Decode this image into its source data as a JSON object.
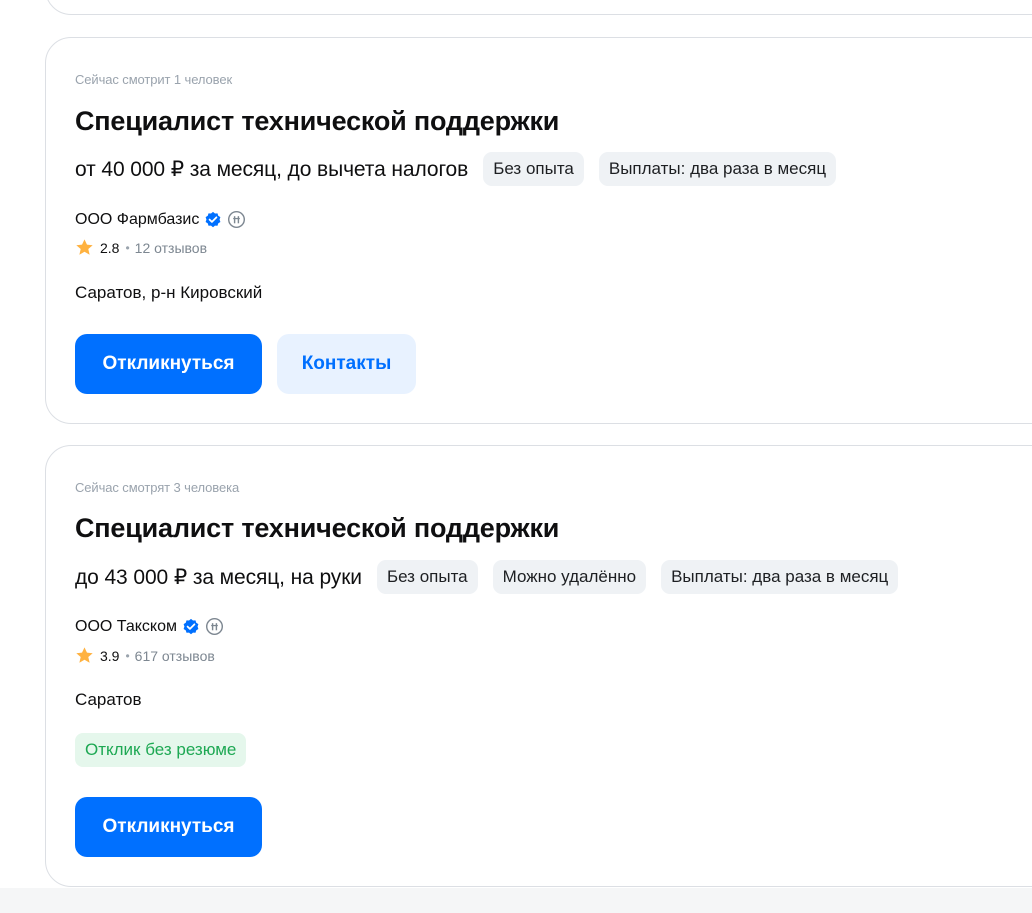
{
  "vacancies": [
    {
      "viewers": "Сейчас смотрит 1 человек",
      "title": "Специалист технической поддержки",
      "salary": "от 40 000 ₽ за месяц, до вычета налогов",
      "tags": [
        "Без опыта",
        "Выплаты: два раза в месяц"
      ],
      "company": "ООО Фармбазис",
      "rating": "2.8",
      "reviews": "12 отзывов",
      "location": "Саратов, р-н Кировский",
      "apply_label": "Откликнуться",
      "contacts_label": "Контакты"
    },
    {
      "viewers": "Сейчас смотрят 3 человека",
      "title": "Специалист технической поддержки",
      "salary": "до 43 000 ₽ за месяц, на руки",
      "tags": [
        "Без опыта",
        "Можно удалённо",
        "Выплаты: два раза в месяц"
      ],
      "company": "ООО Такском",
      "rating": "3.9",
      "reviews": "617 отзывов",
      "location": "Саратов",
      "badge": "Отклик без резюме",
      "apply_label": "Откликнуться"
    }
  ],
  "icons": {
    "verified": "verified-check-icon",
    "info": "info-icon",
    "star": "star-icon"
  },
  "colors": {
    "primary": "#0070ff",
    "secondary_bg": "#e8f2ff",
    "star": "#ffb240",
    "green_text": "#1da853",
    "green_bg": "#e5f7ec",
    "chip_bg": "#eff2f5"
  },
  "separator": "•"
}
